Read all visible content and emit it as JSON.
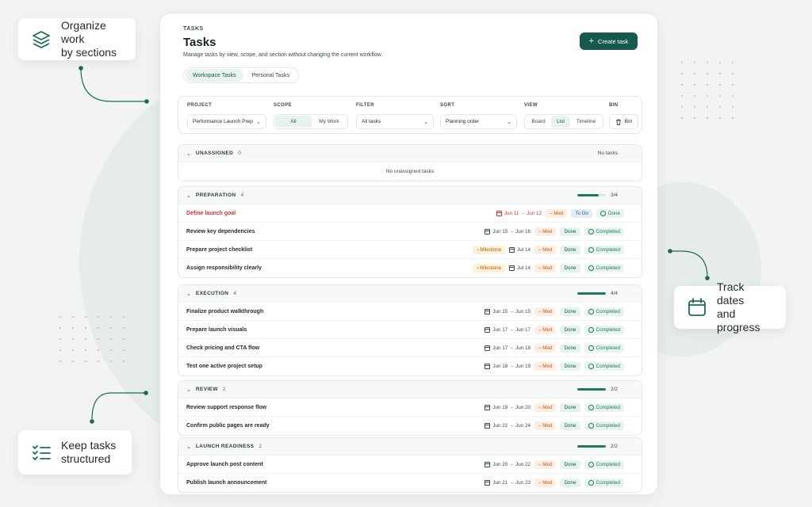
{
  "callouts": {
    "organize": "Organize work\nby sections",
    "structured": "Keep tasks\nstructured",
    "track": "Track dates\nand progress"
  },
  "header": {
    "eyebrow": "TASKS",
    "title": "Tasks",
    "subtitle": "Manage tasks by view, scope, and section without changing the current workflow.",
    "create_label": "Create task"
  },
  "tabs": [
    "Workspace Tasks",
    "Personal Tasks"
  ],
  "filters": {
    "project_label": "PROJECT",
    "project_value": "Performance Launch Prep",
    "scope_label": "SCOPE",
    "scope_options": [
      "All",
      "My Work"
    ],
    "filter_label": "FILTER",
    "filter_value": "All tasks",
    "sort_label": "SORT",
    "sort_value": "Planning order",
    "view_label": "VIEW",
    "view_options": [
      "Board",
      "List",
      "Timeline"
    ],
    "bin_label": "BIN",
    "bin_button": "Bin"
  },
  "sections": [
    {
      "name": "UNASSIGNED",
      "count": "0",
      "right": "No tasks",
      "progress": null,
      "empty": "No unassigned tasks",
      "tasks": []
    },
    {
      "name": "PREPARATION",
      "count": "4",
      "right": "3/4",
      "progress": 0.75,
      "tasks": [
        {
          "name": "Define launch goal",
          "overdue": true,
          "milestone": null,
          "date": "Jun 11 → Jun 12",
          "priority": "– Med",
          "status": "To Do",
          "state": "Done"
        },
        {
          "name": "Review key dependencies",
          "overdue": false,
          "milestone": null,
          "date": "Jun 15 → Jun 16",
          "priority": "– Med",
          "status": "Done",
          "state": "Completed"
        },
        {
          "name": "Prepare project checklist",
          "overdue": false,
          "milestone": "› Milestone",
          "date": "Jul 14",
          "priority": "– Med",
          "status": "Done",
          "state": "Completed"
        },
        {
          "name": "Assign responsibility clearly",
          "overdue": false,
          "milestone": "› Milestone",
          "date": "Jul 14",
          "priority": "– Med",
          "status": "Done",
          "state": "Completed"
        }
      ]
    },
    {
      "name": "EXECUTION",
      "count": "4",
      "right": "4/4",
      "progress": 1,
      "tasks": [
        {
          "name": "Finalize product walkthrough",
          "overdue": false,
          "milestone": null,
          "date": "Jun 15 → Jun 15",
          "priority": "– Med",
          "status": "Done",
          "state": "Completed"
        },
        {
          "name": "Prepare launch visuals",
          "overdue": false,
          "milestone": null,
          "date": "Jun 17 → Jun 17",
          "priority": "– Med",
          "status": "Done",
          "state": "Completed"
        },
        {
          "name": "Check pricing and CTA flow",
          "overdue": false,
          "milestone": null,
          "date": "Jun 17 → Jun 18",
          "priority": "– Med",
          "status": "Done",
          "state": "Completed"
        },
        {
          "name": "Test one active project setup",
          "overdue": false,
          "milestone": null,
          "date": "Jun 18 → Jun 19",
          "priority": "– Med",
          "status": "Done",
          "state": "Completed"
        }
      ]
    },
    {
      "name": "REVIEW",
      "count": "2",
      "right": "2/2",
      "progress": 1,
      "tasks": [
        {
          "name": "Review support response flow",
          "overdue": false,
          "milestone": null,
          "date": "Jun 19 → Jun 20",
          "priority": "– Med",
          "status": "Done",
          "state": "Completed"
        },
        {
          "name": "Confirm public pages are ready",
          "overdue": false,
          "milestone": null,
          "date": "Jun 22 → Jun 24",
          "priority": "– Med",
          "status": "Done",
          "state": "Completed"
        }
      ]
    },
    {
      "name": "LAUNCH READINESS",
      "count": "2",
      "right": "2/2",
      "progress": 1,
      "tasks": [
        {
          "name": "Approve launch post content",
          "overdue": false,
          "milestone": null,
          "date": "Jun 20 → Jun 22",
          "priority": "– Med",
          "status": "Done",
          "state": "Completed"
        },
        {
          "name": "Publish launch announcement",
          "overdue": false,
          "milestone": null,
          "date": "Jun 21 → Jun 23",
          "priority": "– Med",
          "status": "Done",
          "state": "Completed"
        }
      ]
    }
  ]
}
